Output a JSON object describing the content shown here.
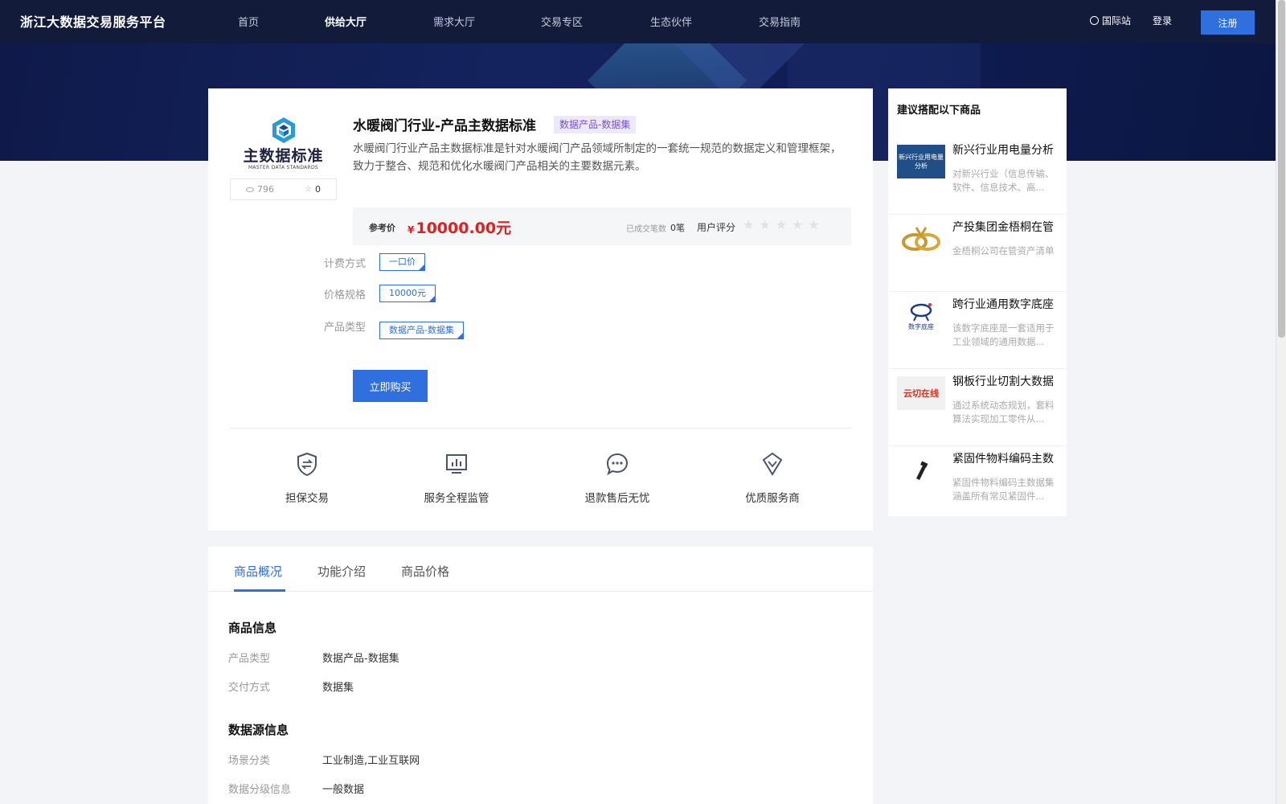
{
  "nav": {
    "brand": "浙江大数据交易服务平台",
    "items": [
      "首页",
      "供给大厅",
      "需求大厅",
      "交易专区",
      "生态伙伴",
      "交易指南"
    ],
    "active_index": 1,
    "intl": "国际站",
    "login": "登录",
    "register": "注册"
  },
  "product": {
    "logo_text": "主数据标准",
    "logo_sub": "MASTER DATA STANDARDS",
    "views": "796",
    "favorites": "0",
    "title": "水暖阀门行业-产品主数据标准",
    "tag": "数据产品-数据集",
    "description": "水暖阀门行业产品主数据标准是针对水暖阀门产品领域所制定的一套统一规范的数据定义和管理框架，致力于整合、规范和优化水暖阀门产品相关的主要数据元素。",
    "price_label": "参考价",
    "currency": "¥",
    "price": "10000.00元",
    "deals_label": "已成交笔数",
    "deals_value": "0笔",
    "rating_label": "用户评分",
    "rating": 0,
    "rating_max": 5,
    "options": [
      {
        "label": "计费方式",
        "value": "一口价"
      },
      {
        "label": "价格规格",
        "value": "10000元"
      },
      {
        "label": "产品类型",
        "value": "数据产品-数据集"
      }
    ],
    "buy_label": "立即购买"
  },
  "features": [
    {
      "label": "担保交易",
      "icon": "shield-exchange-icon"
    },
    {
      "label": "服务全程监管",
      "icon": "monitor-chart-icon"
    },
    {
      "label": "退款售后无忧",
      "icon": "chat-bubble-icon"
    },
    {
      "label": "优质服务商",
      "icon": "diamond-icon"
    }
  ],
  "tabs": [
    "商品概况",
    "功能介绍",
    "商品价格"
  ],
  "details": {
    "section1": "商品信息",
    "rows1": [
      {
        "label": "产品类型",
        "value": "数据产品-数据集"
      },
      {
        "label": "交付方式",
        "value": "数据集"
      }
    ],
    "section2": "数据源信息",
    "rows2": [
      {
        "label": "场景分类",
        "value": "工业制造,工业互联网"
      },
      {
        "label": "数据分级信息",
        "value": "一般数据"
      }
    ]
  },
  "sidebar": {
    "title": "建议搭配以下商品",
    "items": [
      {
        "name": "新兴行业用电量分析",
        "desc": "对新兴行业（信息传输、软件、信息技术、高...",
        "thumb": "新兴行业用电量分析",
        "thumb_color": "#1f4f86"
      },
      {
        "name": "产投集团金梧桐在管",
        "desc": "金梧桐公司在管资产清单",
        "thumb": "",
        "thumb_color": "#ffffff"
      },
      {
        "name": "跨行业通用数字底座",
        "desc": "该数字底座是一套适用于工业领域的通用数据...",
        "thumb": "数字底座",
        "thumb_color": "#ffffff"
      },
      {
        "name": "钢板行业切割大数据",
        "desc": "通过系统动态规划，套料算法实现加工零件从...",
        "thumb": "云切在线",
        "thumb_color": "#f1f1f1"
      },
      {
        "name": "紧固件物料编码主数",
        "desc": "紧固件物料编码主数据集涵盖所有常见紧固件...",
        "thumb": "",
        "thumb_color": "#ffffff"
      }
    ]
  },
  "colors": {
    "accent": "#2f6fde",
    "price": "#e02020",
    "nav_bg": "#131b3a",
    "tag_bg": "#eee8fb",
    "tag_fg": "#7a4fd6"
  }
}
